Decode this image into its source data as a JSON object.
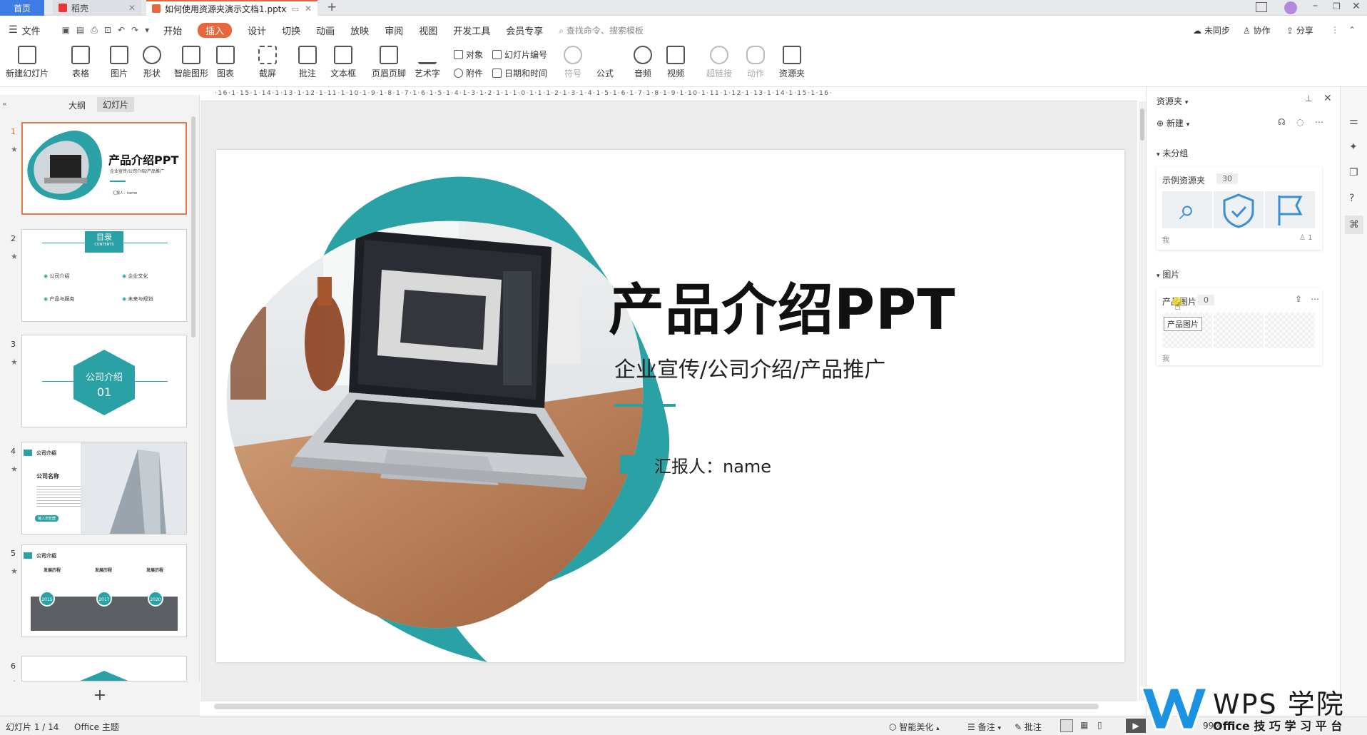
{
  "tabs": {
    "home": "首页",
    "docer": "稻壳",
    "document": "如何使用资源夹演示文档1.pptx"
  },
  "menu": {
    "file": "文件",
    "items": [
      "开始",
      "插入",
      "设计",
      "切换",
      "动画",
      "放映",
      "审阅",
      "视图",
      "开发工具",
      "会员专享"
    ],
    "active": "插入",
    "search": "查找命令、搜索模板",
    "sync": "未同步",
    "collab": "协作",
    "share": "分享"
  },
  "ribbon": {
    "new_slide": "新建幻灯片",
    "table": "表格",
    "picture": "图片",
    "shape": "形状",
    "smart_shape": "智能图形",
    "chart": "图表",
    "screenshot": "截屏",
    "comment": "批注",
    "textbox": "文本框",
    "header_footer": "页眉页脚",
    "art_text": "艺术字",
    "object": "对象",
    "slide_number": "幻灯片编号",
    "attachment": "附件",
    "datetime": "日期和时间",
    "symbol": "符号",
    "formula": "公式",
    "audio": "音频",
    "video": "视频",
    "hyperlink": "超链接",
    "action": "动作",
    "resource_folder": "资源夹"
  },
  "left_panel": {
    "tab_outline": "大纲",
    "tab_slides": "幻灯片",
    "add": "+",
    "slide1": {
      "num": "1",
      "title": "产品介绍PPT",
      "subtitle": "企业宣传/公司介绍/产品推广",
      "reporter": "汇报人：name"
    },
    "slide2": {
      "num": "2",
      "title": "目录",
      "sub": "CONTENTS",
      "items": [
        "公司介绍",
        "企业文化",
        "产品与服务",
        "未来与规划"
      ]
    },
    "slide3": {
      "num": "3",
      "title": "公司介绍",
      "number": "01"
    },
    "slide4": {
      "num": "4",
      "header": "公司介绍",
      "name": "公司名称",
      "button": "输入浏览器"
    },
    "slide5": {
      "num": "5",
      "header": "公司介绍",
      "cols": [
        "发展历程",
        "发展历程",
        "发展历程"
      ],
      "years": [
        "2015",
        "2017",
        "2020"
      ]
    },
    "slide6": {
      "num": "6"
    }
  },
  "ruler": "·16·1·15·1·14·1·13·1·12·1·11·1·10·1·9·1·8·1·7·1·6·1·5·1·4·1·3·1·2·1·1·1·0·1·1·1·2·1·3·1·4·1·5·1·6·1·7·1·8·1·9·1·10·1·11·1·12·1·13·1·14·1·15·1·16·",
  "slide": {
    "title": "产品介绍PPT",
    "subtitle": "企业宣传/公司介绍/产品推广",
    "reporter": "汇报人：name"
  },
  "right_panel": {
    "title": "资源夹",
    "new": "新建",
    "group_ungrouped": "未分组",
    "folder1": {
      "name": "示例资源夹",
      "count": "30",
      "owner": "我",
      "members": "1"
    },
    "group_pictures": "图片",
    "folder2": {
      "name": "产品图片",
      "count": "0",
      "owner": "我",
      "tooltip": "产品图片"
    }
  },
  "status": {
    "slide_info": "幻灯片 1 / 14",
    "theme": "Office 主题",
    "beautify": "智能美化",
    "notes": "备注",
    "comment": "批注",
    "zoom": "99%"
  },
  "watermark": {
    "brand": "WPS 学院",
    "tagline": "Office 技 巧 学 习 平 台"
  },
  "colors": {
    "accent": "#2aa1a5",
    "orange": "#e8663b",
    "tab_blue": "#3c7ce4"
  }
}
